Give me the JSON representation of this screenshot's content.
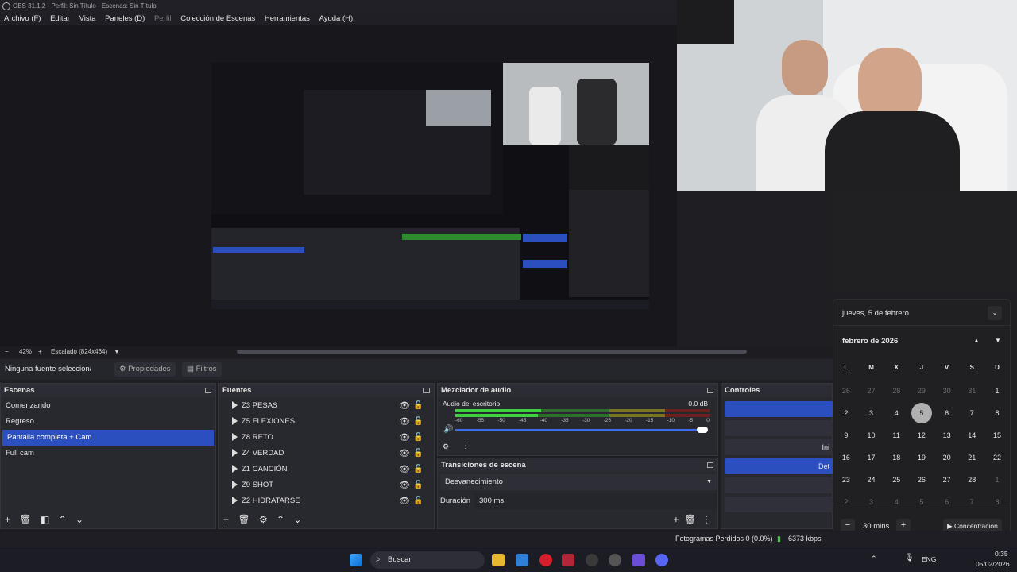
{
  "window": {
    "title": "OBS 31.1.2 - Perfil: Sin Título - Escenas: Sin Título"
  },
  "menu": [
    "Archivo (F)",
    "Editar",
    "Vista",
    "Paneles (D)",
    "Perfil",
    "Colección de Escenas",
    "Herramientas",
    "Ayuda (H)"
  ],
  "zoom": {
    "percent": "42%",
    "scale_label": "Escalado (824x464)"
  },
  "source_bar": {
    "no_source": "Ninguna fuente seleccionada",
    "properties": "Propiedades",
    "filters": "Filtros"
  },
  "scenes": {
    "title": "Escenas",
    "items": [
      "Comenzando",
      "Regreso",
      "Pantalla completa + Cam",
      "Full cam"
    ],
    "selected": 2
  },
  "sources": {
    "title": "Fuentes",
    "items": [
      "Z3 PESAS",
      "Z5 FLEXIONES",
      "Z8 RETO",
      "Z4 VERDAD",
      "Z1 CANCIÓN",
      "Z9 SHOT",
      "Z2 HIDRATARSE"
    ]
  },
  "mixer": {
    "title": "Mezclador de audio",
    "channel": "Audio del escritorio",
    "db": "0.0 dB",
    "scale": [
      "-60",
      "-55",
      "-50",
      "-45",
      "-40",
      "-35",
      "-30",
      "-25",
      "-20",
      "-15",
      "-10",
      "-5",
      "0"
    ]
  },
  "transitions": {
    "title": "Transiciones de escena",
    "selected": "Desvanecimiento",
    "duration_label": "Duración",
    "duration": "300 ms"
  },
  "controls": {
    "title": "Controles",
    "buttons": [
      "",
      "",
      "Ini",
      "Det",
      "",
      ""
    ]
  },
  "calendar": {
    "date_header": "jueves, 5 de febrero",
    "month": "febrero de 2026",
    "weekdays": [
      "L",
      "M",
      "X",
      "J",
      "V",
      "S",
      "D"
    ],
    "weeks": [
      [
        "26",
        "27",
        "28",
        "29",
        "30",
        "31",
        "1"
      ],
      [
        "2",
        "3",
        "4",
        "5",
        "6",
        "7",
        "8"
      ],
      [
        "9",
        "10",
        "11",
        "12",
        "13",
        "14",
        "15"
      ],
      [
        "16",
        "17",
        "18",
        "19",
        "20",
        "21",
        "22"
      ],
      [
        "23",
        "24",
        "25",
        "26",
        "27",
        "28",
        "1"
      ],
      [
        "2",
        "3",
        "4",
        "5",
        "6",
        "7",
        "8"
      ]
    ],
    "today": "5",
    "focus_minutes": "30 mins",
    "focus_button": "Concentración"
  },
  "status": {
    "dropped_frames": "Fotogramas Perdidos 0 (0.0%)",
    "bitrate": "6373 kbps"
  },
  "taskbar": {
    "search_placeholder": "Buscar",
    "lang": "ENG",
    "time": "0:35",
    "date": "05/02/2026"
  }
}
